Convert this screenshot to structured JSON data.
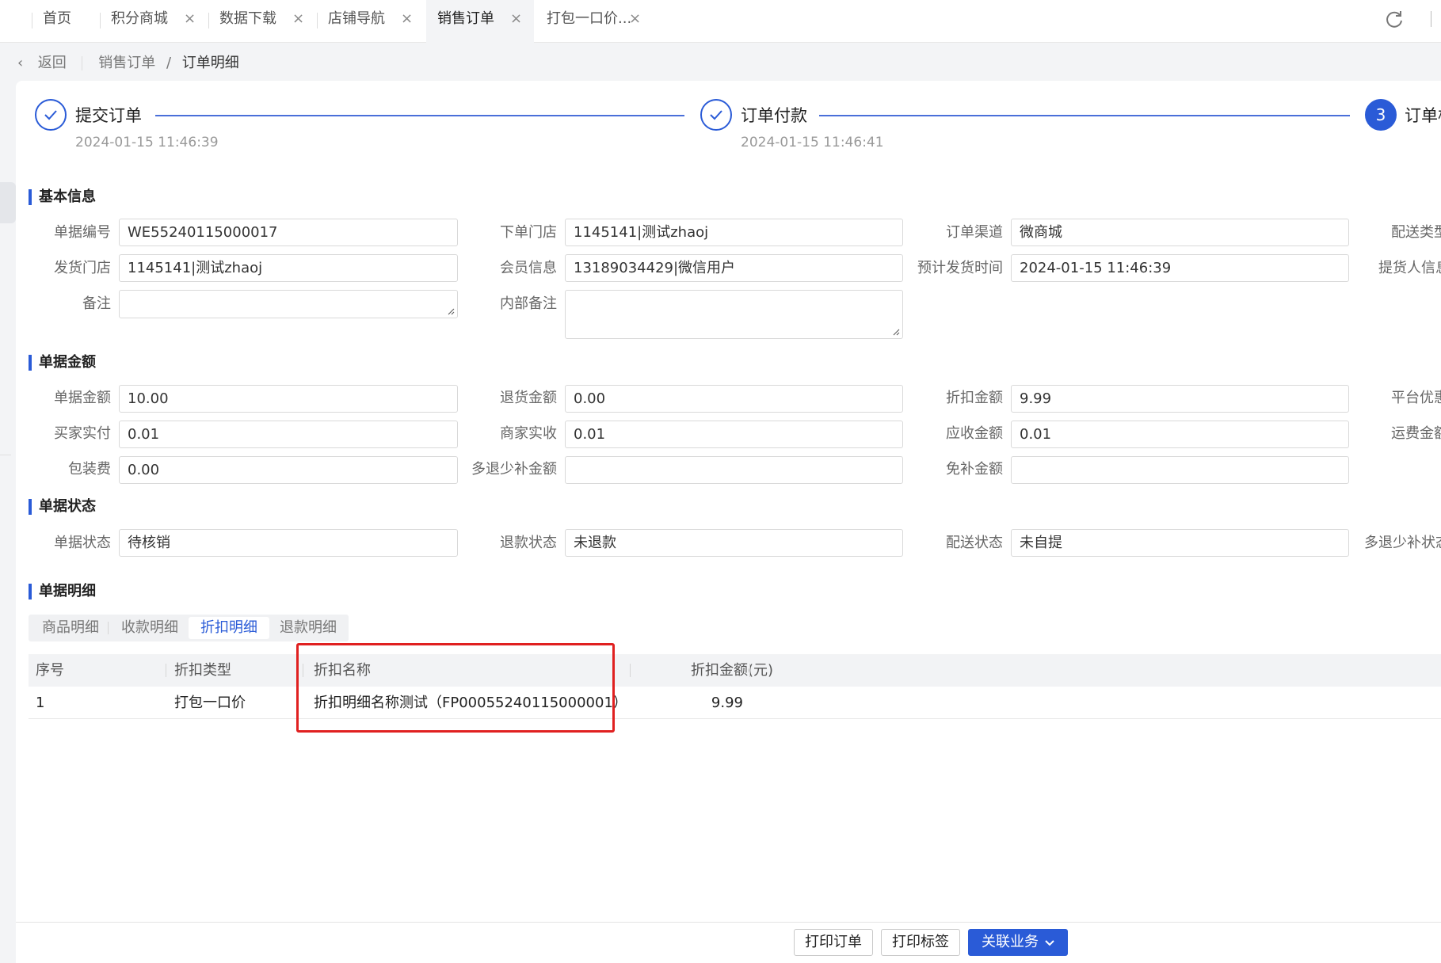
{
  "tabs": [
    {
      "label": "首页",
      "closable": false
    },
    {
      "label": "积分商城",
      "closable": true
    },
    {
      "label": "数据下载",
      "closable": true
    },
    {
      "label": "店铺导航",
      "closable": true
    },
    {
      "label": "销售订单",
      "closable": true,
      "active": true
    },
    {
      "label": "打包一口价...",
      "closable": true
    }
  ],
  "tab_close_glyph": "×",
  "breadcrumb": {
    "back": "返回",
    "parent": "销售订单",
    "separator": "/",
    "current": "订单明细"
  },
  "steps": [
    {
      "title": "提交订单",
      "time": "2024-01-15 11:46:39",
      "status": "done"
    },
    {
      "title": "订单付款",
      "time": "2024-01-15 11:46:41",
      "status": "done"
    },
    {
      "number": "3",
      "title": "订单核",
      "status": "current"
    }
  ],
  "sections": {
    "basic": "基本信息",
    "amount": "单据金额",
    "status": "单据状态",
    "detail": "单据明细"
  },
  "basic_info": {
    "doc_no_label": "单据编号",
    "doc_no": "WE55240115000017",
    "order_store_label": "下单门店",
    "order_store": "1145141|测试zhaoj",
    "channel_label": "订单渠道",
    "channel": "微商城",
    "delivery_type_label": "配送类型",
    "ship_store_label": "发货门店",
    "ship_store": "1145141|测试zhaoj",
    "member_label": "会员信息",
    "member": "13189034429|微信用户",
    "ship_time_label": "预计发货时间",
    "ship_time": "2024-01-15 11:46:39",
    "pickup_label": "提货人信息",
    "remark_label": "备注",
    "remark": "",
    "internal_remark_label": "内部备注",
    "internal_remark": ""
  },
  "amount_info": {
    "doc_amount_label": "单据金额",
    "doc_amount": "10.00",
    "refund_amount_label": "退货金额",
    "refund_amount": "0.00",
    "discount_amount_label": "折扣金额",
    "discount_amount": "9.99",
    "platform_label": "平台优惠",
    "buyer_paid_label": "买家实付",
    "buyer_paid": "0.01",
    "merchant_received_label": "商家实收",
    "merchant_received": "0.01",
    "receivable_label": "应收金额",
    "receivable": "0.01",
    "freight_label": "运费金额",
    "packing_label": "包装费",
    "packing": "0.00",
    "over_refund_label": "多退少补金额",
    "over_refund": "",
    "free_comp_label": "免补金额",
    "free_comp": ""
  },
  "status_info": {
    "doc_status_label": "单据状态",
    "doc_status": "待核销",
    "refund_status_label": "退款状态",
    "refund_status": "未退款",
    "delivery_status_label": "配送状态",
    "delivery_status": "未自提",
    "over_refund_status_label": "多退少补状态"
  },
  "detail_tabs": [
    {
      "label": "商品明细"
    },
    {
      "label": "收款明细"
    },
    {
      "label": "折扣明细",
      "active": true
    },
    {
      "label": "退款明细"
    }
  ],
  "table": {
    "headers": [
      "序号",
      "折扣类型",
      "折扣名称",
      "折扣金额(元)"
    ],
    "rows": [
      [
        "1",
        "打包一口价",
        "折扣明细名称测试（FP00055240115000001）",
        "9.99"
      ]
    ]
  },
  "footer": {
    "print_order": "打印订单",
    "print_label": "打印标签",
    "related": "关联业务"
  },
  "colors": {
    "accent": "#2a5bd7",
    "highlight": "#e02020"
  }
}
